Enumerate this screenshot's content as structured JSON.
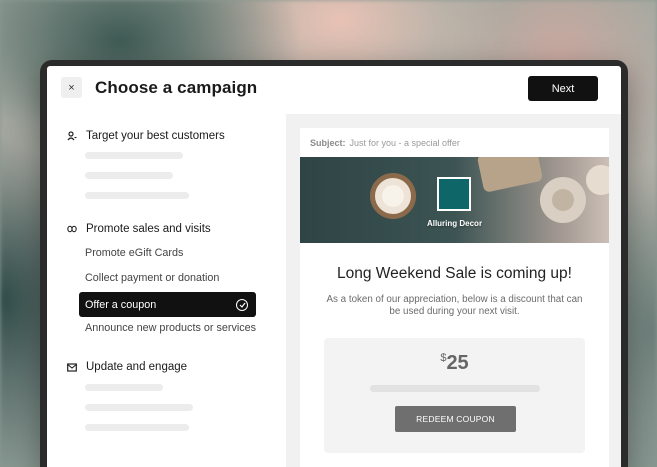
{
  "modal": {
    "title": "Choose a campaign",
    "next_label": "Next",
    "close_glyph": "×"
  },
  "sidebar": {
    "sections": [
      {
        "title": "Target your best customers",
        "icon": "person-icon"
      },
      {
        "title": "Promote sales and visits",
        "icon": "infinity-icon"
      },
      {
        "title": "Update and engage",
        "icon": "mail-icon"
      }
    ],
    "items": [
      {
        "label": "Promote eGift Cards"
      },
      {
        "label": "Collect payment or donation"
      },
      {
        "label": "Offer a coupon",
        "selected": true
      },
      {
        "label": "Announce new products or services"
      }
    ]
  },
  "preview": {
    "subject_label": "Subject:",
    "subject_text": "Just for you - a special offer",
    "brand_name": "Alluring Decor",
    "headline": "Long Weekend Sale is coming up!",
    "body": "As a token of our appreciation, below is a discount that can be used during your next visit.",
    "currency": "$",
    "amount": "25",
    "redeem_label": "REDEEM COUPON"
  },
  "colors": {
    "accent_dark": "#111111",
    "brand_teal": "#0f6668"
  }
}
